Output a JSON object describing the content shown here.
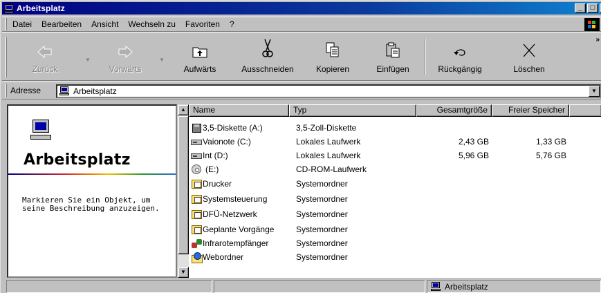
{
  "window": {
    "title": "Arbeitsplatz",
    "controls": {
      "minimize": "_",
      "maximize": "□",
      "close": "×"
    }
  },
  "menu": {
    "items": [
      "Datei",
      "Bearbeiten",
      "Ansicht",
      "Wechseln zu",
      "Favoriten",
      "?"
    ]
  },
  "toolbar": {
    "buttons": [
      {
        "label": "Zurück",
        "icon": "back-arrow-icon",
        "enabled": false
      },
      {
        "label": "Vorwärts",
        "icon": "forward-arrow-icon",
        "enabled": false
      },
      {
        "label": "Aufwärts",
        "icon": "up-folder-icon",
        "enabled": true
      },
      {
        "label": "Ausschneiden",
        "icon": "scissors-icon",
        "enabled": true
      },
      {
        "label": "Kopieren",
        "icon": "copy-icon",
        "enabled": true
      },
      {
        "label": "Einfügen",
        "icon": "paste-icon",
        "enabled": true
      },
      {
        "label": "Rückgängig",
        "icon": "undo-icon",
        "enabled": true
      },
      {
        "label": "Löschen",
        "icon": "delete-x-icon",
        "enabled": true
      }
    ]
  },
  "address": {
    "label": "Adresse",
    "value": "Arbeitsplatz"
  },
  "info_pane": {
    "title": "Arbeitsplatz",
    "description": "Markieren Sie ein Objekt, um seine Beschreibung anzuzeigen."
  },
  "list": {
    "columns": [
      "Name",
      "Typ",
      "Gesamtgröße",
      "Freier Speicher"
    ],
    "rows": [
      {
        "name": "3,5-Diskette (A:)",
        "type": "3,5-Zoll-Diskette",
        "total": "",
        "free": "",
        "icon": "floppy-icon"
      },
      {
        "name": "Vaionote (C:)",
        "type": "Lokales Laufwerk",
        "total": "2,43 GB",
        "free": "1,33 GB",
        "icon": "hard-drive-icon"
      },
      {
        "name": "Int (D:)",
        "type": "Lokales Laufwerk",
        "total": "5,96 GB",
        "free": "5,76 GB",
        "icon": "hard-drive-icon"
      },
      {
        "name": "(E:)",
        "type": "CD-ROM-Laufwerk",
        "total": "",
        "free": "",
        "icon": "cdrom-icon"
      },
      {
        "name": "Drucker",
        "type": "Systemordner",
        "total": "",
        "free": "",
        "icon": "printers-folder-icon"
      },
      {
        "name": "Systemsteuerung",
        "type": "Systemordner",
        "total": "",
        "free": "",
        "icon": "control-panel-folder-icon"
      },
      {
        "name": "DFÜ-Netzwerk",
        "type": "Systemordner",
        "total": "",
        "free": "",
        "icon": "dialup-folder-icon"
      },
      {
        "name": "Geplante Vorgänge",
        "type": "Systemordner",
        "total": "",
        "free": "",
        "icon": "scheduled-tasks-folder-icon"
      },
      {
        "name": "Infrarotempfänger",
        "type": "Systemordner",
        "total": "",
        "free": "",
        "icon": "infrared-icon"
      },
      {
        "name": "Webordner",
        "type": "Systemordner",
        "total": "",
        "free": "",
        "icon": "web-folder-icon"
      }
    ]
  },
  "status": {
    "location": "Arbeitsplatz"
  },
  "colors": {
    "title_gradient_start": "#000080",
    "title_gradient_end": "#1084d0",
    "window_face": "#c0c0c0"
  }
}
